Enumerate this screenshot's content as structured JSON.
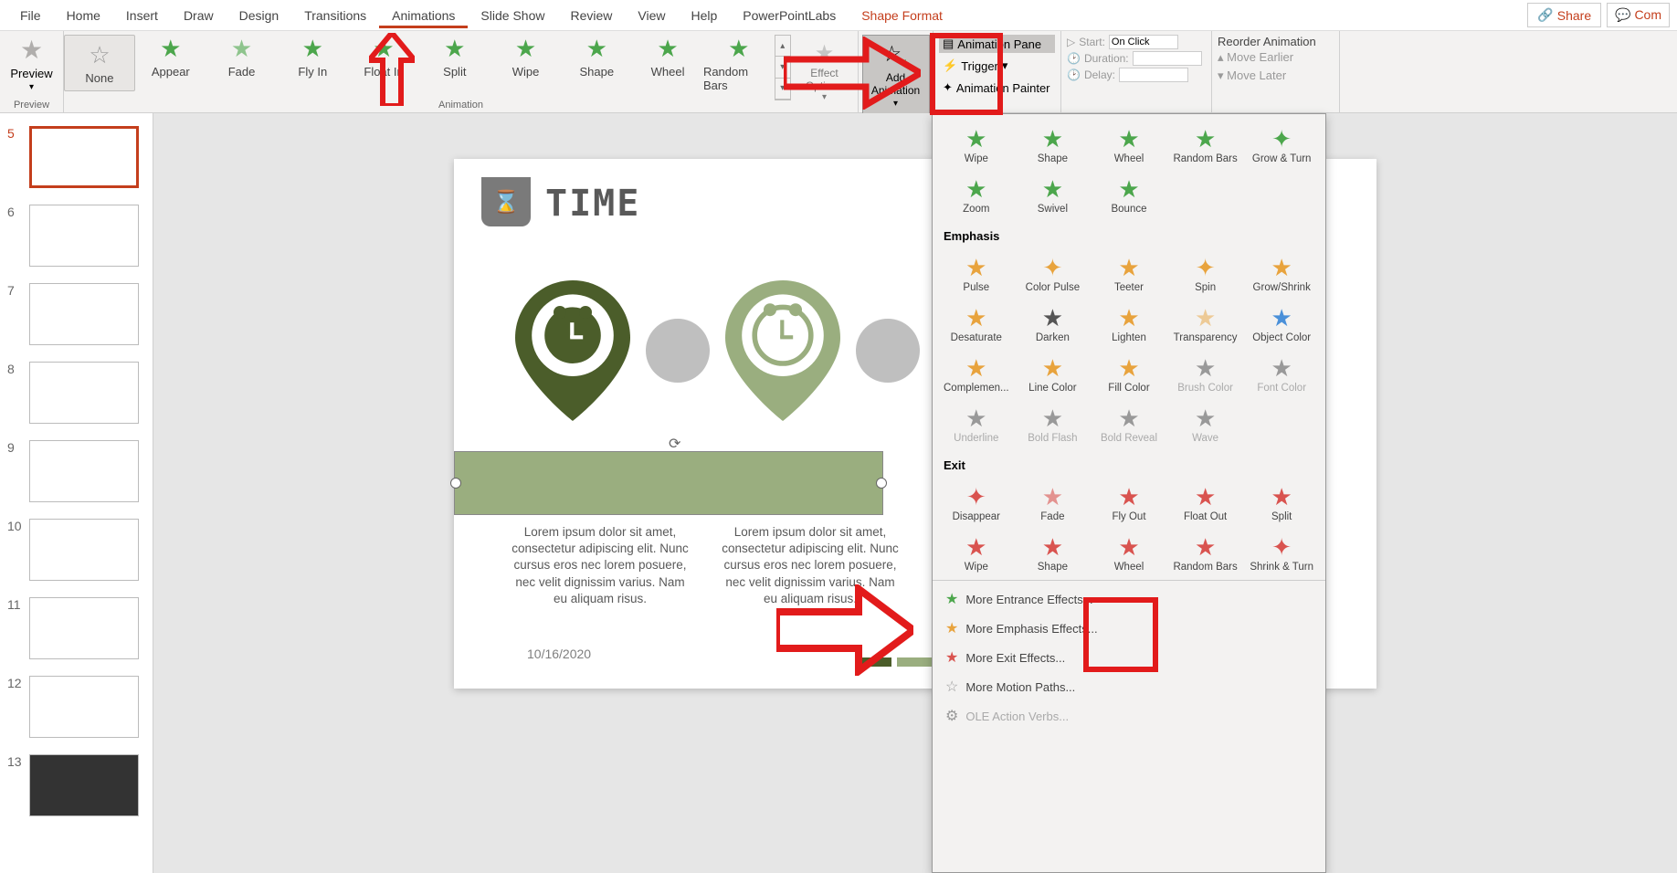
{
  "menubar": {
    "items": [
      "File",
      "Home",
      "Insert",
      "Draw",
      "Design",
      "Transitions",
      "Animations",
      "Slide Show",
      "Review",
      "View",
      "Help",
      "PowerPointLabs",
      "Shape Format"
    ],
    "activeIndex": 6,
    "specialIndex": 12,
    "share": "Share",
    "com": "Com"
  },
  "ribbon": {
    "preview": {
      "label": "Preview",
      "group": "Preview"
    },
    "gallery": [
      "None",
      "Appear",
      "Fade",
      "Fly In",
      "Float In",
      "Split",
      "Wipe",
      "Shape",
      "Wheel",
      "Random Bars"
    ],
    "gallery_group": "Animation",
    "effect_options": "Effect Options",
    "add_animation": "Add Animation",
    "advanced": {
      "pane": "Animation Pane",
      "trigger": "Trigger",
      "painter": "Animation Painter"
    },
    "timing": {
      "start_lbl": "Start:",
      "start_val": "On Click",
      "duration": "Duration:",
      "delay": "Delay:"
    },
    "reorder": {
      "title": "Reorder Animation",
      "earlier": "Move Earlier",
      "later": "Move Later"
    }
  },
  "thumbs": {
    "start": 5,
    "count": 9,
    "selected": 5
  },
  "slide": {
    "title": "TIME",
    "paragraph": "Lorem ipsum dolor sit amet, consectetur adipiscing elit. Nunc cursus eros nec lorem posuere, nec velit dignissim varius. Nam eu aliquam risus.",
    "date": "10/16/2020",
    "chip_colors": [
      "#4b5d2a",
      "#9aae7f",
      "#e8a33d"
    ]
  },
  "dropdown": {
    "row1": [
      "Wipe",
      "Shape",
      "Wheel",
      "Random Bars",
      "Grow & Turn"
    ],
    "row2": [
      "Zoom",
      "Swivel",
      "Bounce"
    ],
    "emphasis_head": "Emphasis",
    "emph1": [
      "Pulse",
      "Color Pulse",
      "Teeter",
      "Spin",
      "Grow/Shrink"
    ],
    "emph2": [
      "Desaturate",
      "Darken",
      "Lighten",
      "Transparency",
      "Object Color"
    ],
    "emph3": [
      "Complemen...",
      "Line Color",
      "Fill Color",
      "Brush Color",
      "Font Color"
    ],
    "emph4": [
      "Underline",
      "Bold Flash",
      "Bold Reveal",
      "Wave"
    ],
    "exit_head": "Exit",
    "exit1": [
      "Disappear",
      "Fade",
      "Fly Out",
      "Float Out",
      "Split"
    ],
    "exit2": [
      "Wipe",
      "Shape",
      "Wheel",
      "Random Bars",
      "Shrink & Turn"
    ],
    "links": {
      "entrance": "More Entrance Effects...",
      "emphasis": "More Emphasis Effects...",
      "exit": "More Exit Effects...",
      "motion": "More Motion Paths...",
      "ole": "OLE Action Verbs..."
    }
  }
}
